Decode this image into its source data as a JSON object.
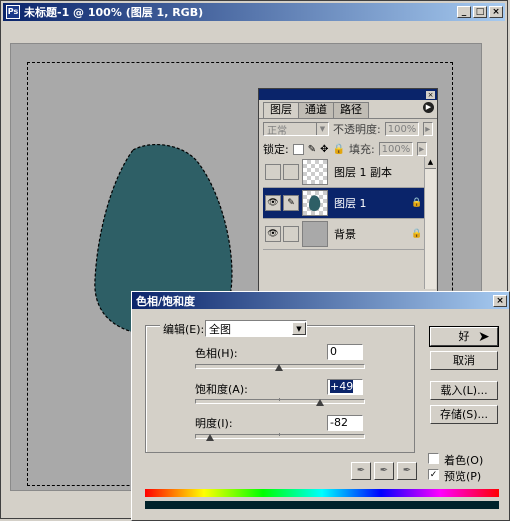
{
  "document": {
    "title": "未标题-1 @ 100% (图层 1, RGB)",
    "min": "_",
    "max": "□",
    "close": "×"
  },
  "layers_panel": {
    "tabs": [
      {
        "label": "图层"
      },
      {
        "label": "通道"
      },
      {
        "label": "路径"
      }
    ],
    "blend_mode": "正常",
    "opacity_label": "不透明度:",
    "opacity_value": "100%",
    "lock_label": "锁定:",
    "fill_label": "填充:",
    "fill_value": "100%",
    "layers": [
      {
        "name": "图层 1 副本"
      },
      {
        "name": "图层 1"
      },
      {
        "name": "背景"
      }
    ]
  },
  "dialog": {
    "title": "色相/饱和度",
    "close": "×",
    "edit_label": "编辑(E):",
    "edit_value": "全图",
    "hue_label": "色相(H):",
    "hue_value": "0",
    "hue_level": 0.5,
    "saturation_label": "饱和度(A):",
    "saturation_value": "+49",
    "saturation_level": 0.745,
    "lightness_label": "明度(I):",
    "lightness_value": "-82",
    "lightness_level": 0.09,
    "ok": "好",
    "cancel": "取消",
    "load": "载入(L)...",
    "save": "存储(S)...",
    "colorize_label": "着色(O)",
    "colorize_checked": false,
    "preview_label": "预览(P)",
    "preview_checked": true
  },
  "colors": {
    "blob": "#2e5f66",
    "canvas": "#a9a9a9",
    "title_start": "#0a246a"
  }
}
